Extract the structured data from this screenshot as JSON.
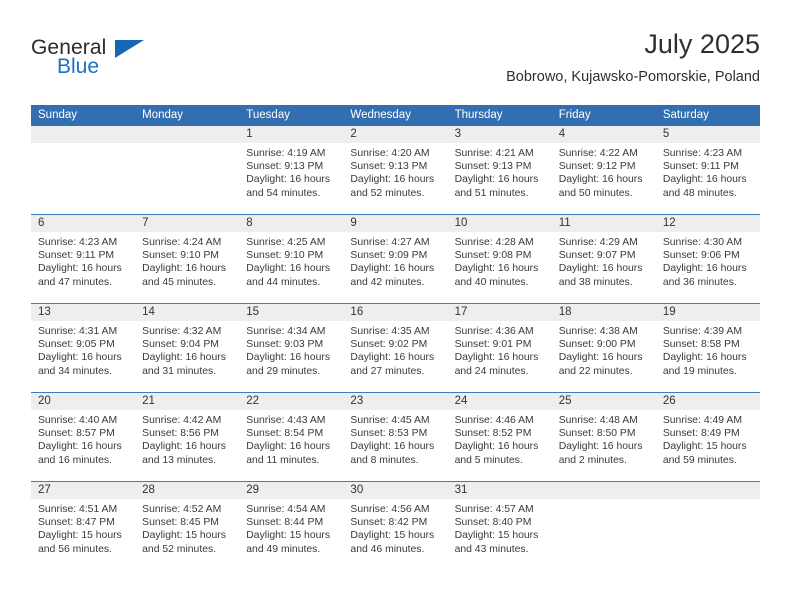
{
  "brand": {
    "logo_primary": "General",
    "logo_secondary": "Blue",
    "logo_triangle_icon": "triangle-icon",
    "primary_color": "#2b2b2b",
    "accent_color": "#1b72c0"
  },
  "header": {
    "title": "July 2025",
    "subtitle": "Bobrowo, Kujawsko-Pomorskie, Poland"
  },
  "calendar": {
    "header_bg": "#336fb0",
    "row_divider_color": "#3b7ec0",
    "date_band_bg": "#eeeeee",
    "day_names": [
      "Sunday",
      "Monday",
      "Tuesday",
      "Wednesday",
      "Thursday",
      "Friday",
      "Saturday"
    ],
    "weeks": [
      [
        {
          "day": "",
          "lines": []
        },
        {
          "day": "",
          "lines": []
        },
        {
          "day": "1",
          "lines": [
            "Sunrise: 4:19 AM",
            "Sunset: 9:13 PM",
            "Daylight: 16 hours",
            "and 54 minutes."
          ]
        },
        {
          "day": "2",
          "lines": [
            "Sunrise: 4:20 AM",
            "Sunset: 9:13 PM",
            "Daylight: 16 hours",
            "and 52 minutes."
          ]
        },
        {
          "day": "3",
          "lines": [
            "Sunrise: 4:21 AM",
            "Sunset: 9:13 PM",
            "Daylight: 16 hours",
            "and 51 minutes."
          ]
        },
        {
          "day": "4",
          "lines": [
            "Sunrise: 4:22 AM",
            "Sunset: 9:12 PM",
            "Daylight: 16 hours",
            "and 50 minutes."
          ]
        },
        {
          "day": "5",
          "lines": [
            "Sunrise: 4:23 AM",
            "Sunset: 9:11 PM",
            "Daylight: 16 hours",
            "and 48 minutes."
          ]
        }
      ],
      [
        {
          "day": "6",
          "lines": [
            "Sunrise: 4:23 AM",
            "Sunset: 9:11 PM",
            "Daylight: 16 hours",
            "and 47 minutes."
          ]
        },
        {
          "day": "7",
          "lines": [
            "Sunrise: 4:24 AM",
            "Sunset: 9:10 PM",
            "Daylight: 16 hours",
            "and 45 minutes."
          ]
        },
        {
          "day": "8",
          "lines": [
            "Sunrise: 4:25 AM",
            "Sunset: 9:10 PM",
            "Daylight: 16 hours",
            "and 44 minutes."
          ]
        },
        {
          "day": "9",
          "lines": [
            "Sunrise: 4:27 AM",
            "Sunset: 9:09 PM",
            "Daylight: 16 hours",
            "and 42 minutes."
          ]
        },
        {
          "day": "10",
          "lines": [
            "Sunrise: 4:28 AM",
            "Sunset: 9:08 PM",
            "Daylight: 16 hours",
            "and 40 minutes."
          ]
        },
        {
          "day": "11",
          "lines": [
            "Sunrise: 4:29 AM",
            "Sunset: 9:07 PM",
            "Daylight: 16 hours",
            "and 38 minutes."
          ]
        },
        {
          "day": "12",
          "lines": [
            "Sunrise: 4:30 AM",
            "Sunset: 9:06 PM",
            "Daylight: 16 hours",
            "and 36 minutes."
          ]
        }
      ],
      [
        {
          "day": "13",
          "lines": [
            "Sunrise: 4:31 AM",
            "Sunset: 9:05 PM",
            "Daylight: 16 hours",
            "and 34 minutes."
          ]
        },
        {
          "day": "14",
          "lines": [
            "Sunrise: 4:32 AM",
            "Sunset: 9:04 PM",
            "Daylight: 16 hours",
            "and 31 minutes."
          ]
        },
        {
          "day": "15",
          "lines": [
            "Sunrise: 4:34 AM",
            "Sunset: 9:03 PM",
            "Daylight: 16 hours",
            "and 29 minutes."
          ]
        },
        {
          "day": "16",
          "lines": [
            "Sunrise: 4:35 AM",
            "Sunset: 9:02 PM",
            "Daylight: 16 hours",
            "and 27 minutes."
          ]
        },
        {
          "day": "17",
          "lines": [
            "Sunrise: 4:36 AM",
            "Sunset: 9:01 PM",
            "Daylight: 16 hours",
            "and 24 minutes."
          ]
        },
        {
          "day": "18",
          "lines": [
            "Sunrise: 4:38 AM",
            "Sunset: 9:00 PM",
            "Daylight: 16 hours",
            "and 22 minutes."
          ]
        },
        {
          "day": "19",
          "lines": [
            "Sunrise: 4:39 AM",
            "Sunset: 8:58 PM",
            "Daylight: 16 hours",
            "and 19 minutes."
          ]
        }
      ],
      [
        {
          "day": "20",
          "lines": [
            "Sunrise: 4:40 AM",
            "Sunset: 8:57 PM",
            "Daylight: 16 hours",
            "and 16 minutes."
          ]
        },
        {
          "day": "21",
          "lines": [
            "Sunrise: 4:42 AM",
            "Sunset: 8:56 PM",
            "Daylight: 16 hours",
            "and 13 minutes."
          ]
        },
        {
          "day": "22",
          "lines": [
            "Sunrise: 4:43 AM",
            "Sunset: 8:54 PM",
            "Daylight: 16 hours",
            "and 11 minutes."
          ]
        },
        {
          "day": "23",
          "lines": [
            "Sunrise: 4:45 AM",
            "Sunset: 8:53 PM",
            "Daylight: 16 hours",
            "and 8 minutes."
          ]
        },
        {
          "day": "24",
          "lines": [
            "Sunrise: 4:46 AM",
            "Sunset: 8:52 PM",
            "Daylight: 16 hours",
            "and 5 minutes."
          ]
        },
        {
          "day": "25",
          "lines": [
            "Sunrise: 4:48 AM",
            "Sunset: 8:50 PM",
            "Daylight: 16 hours",
            "and 2 minutes."
          ]
        },
        {
          "day": "26",
          "lines": [
            "Sunrise: 4:49 AM",
            "Sunset: 8:49 PM",
            "Daylight: 15 hours",
            "and 59 minutes."
          ]
        }
      ],
      [
        {
          "day": "27",
          "lines": [
            "Sunrise: 4:51 AM",
            "Sunset: 8:47 PM",
            "Daylight: 15 hours",
            "and 56 minutes."
          ]
        },
        {
          "day": "28",
          "lines": [
            "Sunrise: 4:52 AM",
            "Sunset: 8:45 PM",
            "Daylight: 15 hours",
            "and 52 minutes."
          ]
        },
        {
          "day": "29",
          "lines": [
            "Sunrise: 4:54 AM",
            "Sunset: 8:44 PM",
            "Daylight: 15 hours",
            "and 49 minutes."
          ]
        },
        {
          "day": "30",
          "lines": [
            "Sunrise: 4:56 AM",
            "Sunset: 8:42 PM",
            "Daylight: 15 hours",
            "and 46 minutes."
          ]
        },
        {
          "day": "31",
          "lines": [
            "Sunrise: 4:57 AM",
            "Sunset: 8:40 PM",
            "Daylight: 15 hours",
            "and 43 minutes."
          ]
        },
        {
          "day": "",
          "lines": []
        },
        {
          "day": "",
          "lines": []
        }
      ]
    ]
  }
}
